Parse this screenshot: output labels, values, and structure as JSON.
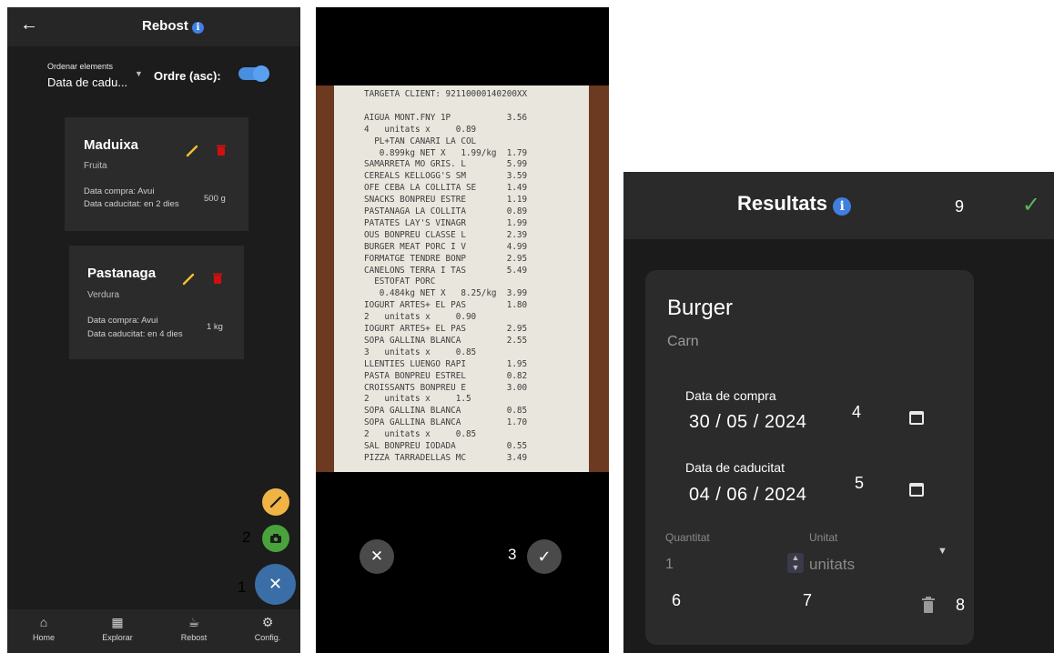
{
  "panel1": {
    "header": {
      "title": "Rebost"
    },
    "sort": {
      "label": "Ordenar elements",
      "value": "Data de cadu...",
      "order_label": "Ordre (asc):"
    },
    "items": [
      {
        "name": "Maduixa",
        "category": "Fruita",
        "purchase": "Data compra: Avui",
        "expiry": "Data caducitat: en 2 dies",
        "quantity": "500 g"
      },
      {
        "name": "Pastanaga",
        "category": "Verdura",
        "purchase": "Data compra: Avui",
        "expiry": "Data caducitat: en 4 dies",
        "quantity": "1 kg"
      }
    ],
    "annotations": {
      "camera": "2",
      "close": "1"
    },
    "nav": [
      {
        "label": "Home",
        "icon": "home-icon"
      },
      {
        "label": "Explorar",
        "icon": "map-icon"
      },
      {
        "label": "Rebost",
        "icon": "pantry-icon"
      },
      {
        "label": "Config.",
        "icon": "settings-icon"
      }
    ]
  },
  "panel2": {
    "receipt_lines": [
      "TARGETA CLIENT: 92110000140200XX",
      "",
      "AIGUA MONT.FNY 1P           3.56",
      "4   unitats x     0.89",
      "  PL+TAN CANARI LA COL",
      "   0.899kg NET X   1.99/kg  1.79",
      "SAMARRETA MO GRIS. L        5.99",
      "CEREALS KELLOGG'S SM        3.59",
      "OFE CEBA LA COLLITA SE      1.49",
      "SNACKS BONPREU ESTRE        1.19",
      "PASTANAGA LA COLLITA        0.89",
      "PATATES LAY'S VINAGR        1.99",
      "OUS BONPREU CLASSE L        2.39",
      "BURGER MEAT PORC I V        4.99",
      "FORMATGE TENDRE BONP        2.95",
      "CANELONS TERRA I TAS        5.49",
      "  ESTOFAT PORC",
      "   0.484kg NET X   8.25/kg  3.99",
      "IOGURT ARTES+ EL PAS        1.80",
      "2   unitats x     0.90",
      "IOGURT ARTES+ EL PAS        2.95",
      "SOPA GALLINA BLANCA         2.55",
      "3   unitats x     0.85",
      "LLENTIES LUENGO RAPI        1.95",
      "PASTA BONPREU ESTREL        0.82",
      "CROISSANTS BONPREU E        3.00",
      "2   unitats x     1.5",
      "SOPA GALLINA BLANCA         0.85",
      "SOPA GALLINA BLANCA         1.70",
      "2   unitats x     0.85",
      "SAL BONPREU IODADA          0.55",
      "PIZZA TARRADELLAS MC        3.49"
    ],
    "annotations": {
      "confirm": "3"
    }
  },
  "panel3": {
    "header": {
      "title": "Resultats",
      "annotation": "9"
    },
    "product": {
      "name": "Burger",
      "category": "Carn"
    },
    "purchase_date": {
      "label": "Data de compra",
      "value": "30 / 05 / 2024",
      "annotation": "4"
    },
    "expiry_date": {
      "label": "Data de caducitat",
      "value": "04 / 06 / 2024",
      "annotation": "5"
    },
    "quantity": {
      "label": "Quantitat",
      "value": "1",
      "annotation": "6"
    },
    "unit": {
      "label": "Unitat",
      "value": "unitats",
      "annotation": "7"
    },
    "delete_annotation": "8"
  }
}
